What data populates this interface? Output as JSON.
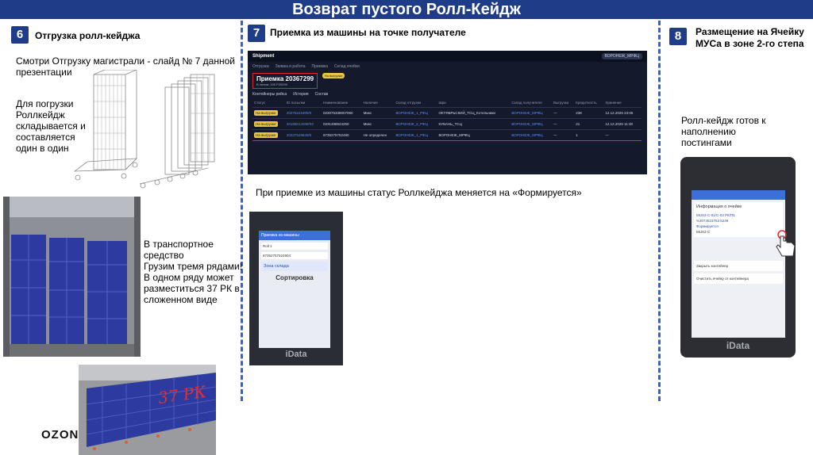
{
  "title": "Возврат пустого Ролл-Кейдж",
  "sections": [
    {
      "number": "6",
      "title": "Отгрузка ролл-кейджа"
    },
    {
      "number": "7",
      "title": "Приемка из машины на точке получателе"
    },
    {
      "number": "8",
      "title_line1": "Размещение на Ячейку",
      "title_line2": "МУСа в зоне 2-го степа"
    }
  ],
  "section6": {
    "text1_line1": "Смотри Отгрузку магистрали - слайд № 7 данной",
    "text1_line2": "презентации",
    "text2_lines": [
      "Для погрузки",
      "Роллкейдж",
      "складывается  и",
      "составляется",
      "один в один"
    ],
    "text3_lines": [
      "В транспортное",
      "средство",
      "Грузим тремя рядами!",
      "В одном ряду может",
      "разместиться 37 РК в",
      "сложенном виде"
    ],
    "handwritten": "37 РК"
  },
  "section7": {
    "caption": "При приемке из машины статус Роллкейджа меняется на «Формируется»",
    "app": {
      "logo": "Shipment",
      "nav": [
        "Отгрузка",
        "Заявка и работа",
        "Приемка",
        "Склад ячейки"
      ],
      "header_tag": "ВОРОНЕЖ_МРФЦ",
      "receipt_title": "Приемка 20367299",
      "receipt_sub": "В линии: 195 Р20299",
      "status_chip": "На выгрузке",
      "tabs": [
        "Контейнеры рейса",
        "История",
        "Состав"
      ],
      "table_headers": [
        "Статус",
        "ID посылки",
        "Наименование",
        "Наличие",
        "Склад отгрузки",
        "Шри",
        "Склад получателя",
        "Выгрузка",
        "Кредитность",
        "Хранение"
      ],
      "rows": [
        {
          "status": "На выгрузке",
          "id": "20276221809/0",
          "barcode": "023075338007050",
          "type": "Микс",
          "from": "ВОРОНЕЖ_1_РФЦ",
          "to": "ОКТЯБРЬСКИЙ_ТСЦ_Котельники",
          "dest": "ВОРОНЕЖ_МРФЦ",
          "out": "—",
          "qty": "238",
          "date": "12.12.2025 23:05"
        },
        {
          "status": "На выгрузке",
          "id": "20196014208/03",
          "barcode": "0231498624250",
          "type": "Микс",
          "from": "ВОРОНЕЖ_2_РФЦ",
          "to": "КУБАНЬ_ТСЦ",
          "dest": "ВОРОНЕЖ_МРФЦ",
          "out": "—",
          "qty": "21",
          "date": "12.12.2025 11:30"
        },
        {
          "status": "На выгрузке",
          "id": "20237525849/0",
          "barcode": "9735275752490",
          "type": "Не определен",
          "from": "ВОРОНЕЖ_1_РФЦ",
          "to": "ВОРОНЕЖ_МРФЦ",
          "dest": "ВОРОНЕЖ_МРФЦ",
          "out": "—",
          "qty": "1",
          "date": "—"
        }
      ]
    },
    "device": {
      "header": "Приемка из машины",
      "field1": "Roll 1",
      "field2": "97352757524904",
      "zone": "Зона склада",
      "action": "Сортировка",
      "brand": "iData"
    }
  },
  "section8": {
    "caption_lines": [
      "Ролл-кейдж готов к",
      "наполнению",
      "постингами"
    ],
    "device": {
      "card_title": "Информация о ячейке",
      "cell": "MUS2-C-01/C-03 РК/П5",
      "container": "%3074523753 5249",
      "container_status": "Формируется",
      "location": "MUS2-C",
      "btn1": "Закрыть контейнер",
      "btn2": "Очистить ячейку от контейнера",
      "brand": "iData"
    }
  },
  "logo": "OZON"
}
